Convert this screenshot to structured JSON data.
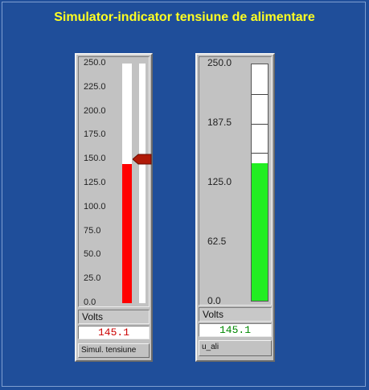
{
  "title": "Simulator-indicator tensiune de alimentare",
  "colors": {
    "background": "#1f4e9a",
    "title": "#ffff22",
    "left_fill": "#ff0000",
    "right_fill": "#22ee22",
    "left_value_text": "#cc0000",
    "right_value_text": "#008800",
    "pointer": "#b01a08"
  },
  "left_meter": {
    "scale_min": 0,
    "scale_max": 250,
    "ticks": [
      "250.0",
      "225.0",
      "200.0",
      "175.0",
      "150.0",
      "125.0",
      "100.0",
      "75.0",
      "50.0",
      "25.0",
      "0.0"
    ],
    "level": 145.1,
    "pointer_level": 150,
    "pointer_icon": "slider-pointer-icon",
    "units": "Volts",
    "value": "145.1",
    "name": "Simul. tensiune"
  },
  "right_meter": {
    "scale_min": 0,
    "scale_max": 250,
    "ticks": [
      "250.0",
      "187.5",
      "125.0",
      "62.5",
      "0.0"
    ],
    "segments": 8,
    "level": 145.1,
    "units": "Volts",
    "value": "145.1",
    "name": "u_ali"
  }
}
